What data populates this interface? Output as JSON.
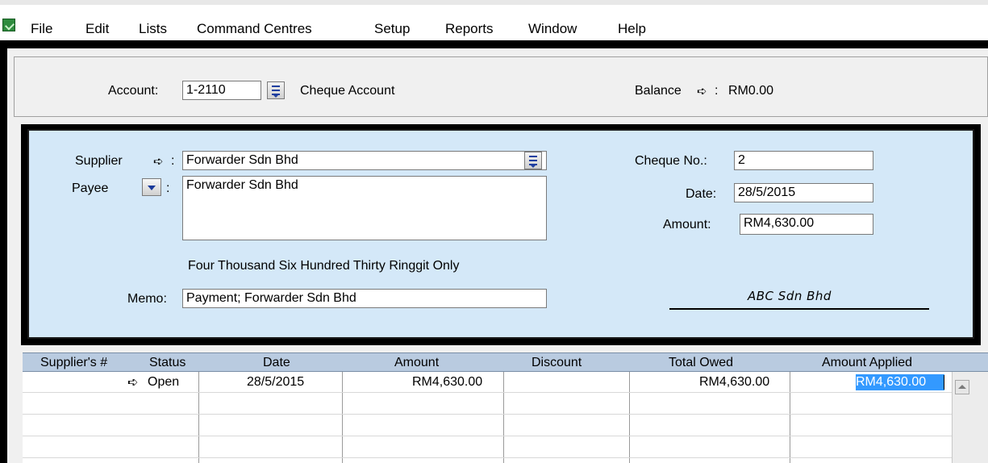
{
  "menu": {
    "items": [
      "File",
      "Edit",
      "Lists",
      "Command Centres",
      "Setup",
      "Reports",
      "Window",
      "Help"
    ]
  },
  "account": {
    "label": "Account:",
    "number": "1-2110",
    "name": "Cheque Account",
    "balance_label": "Balance",
    "balance_suffix": ":",
    "balance_value": "RM0.00"
  },
  "cheque": {
    "supplier_label": "Supplier",
    "supplier_suffix": ":",
    "supplier_value": "Forwarder Sdn Bhd",
    "payee_label": "Payee",
    "payee_suffix": ":",
    "payee_value": "Forwarder Sdn Bhd",
    "amount_words": "Four Thousand Six Hundred Thirty Ringgit Only",
    "memo_label": "Memo:",
    "memo_value": "Payment; Forwarder Sdn Bhd",
    "cheque_no_label": "Cheque No.:",
    "cheque_no_value": "2",
    "date_label": "Date:",
    "date_value": "28/5/2015",
    "amount_label": "Amount:",
    "amount_value": "RM4,630.00",
    "signature": "ABC Sdn Bhd"
  },
  "table": {
    "columns": [
      "Supplier's #",
      "Status",
      "Date",
      "Amount",
      "Discount",
      "Total Owed",
      "Amount Applied"
    ],
    "rows": [
      {
        "supplier_no": "",
        "status": "Open",
        "date": "28/5/2015",
        "amount": "RM4,630.00",
        "discount": "",
        "total_owed": "RM4,630.00",
        "amount_applied": "RM4,630.00"
      }
    ]
  },
  "icons": {
    "arrow": "right-arrow-icon",
    "list": "list-select-icon",
    "dropdown": "dropdown-arrow-icon",
    "scroll_up": "scroll-up-icon"
  },
  "colors": {
    "cheque_background": "#d4e8f8",
    "table_header": "#b9cbe0",
    "selection": "#3399ff"
  }
}
